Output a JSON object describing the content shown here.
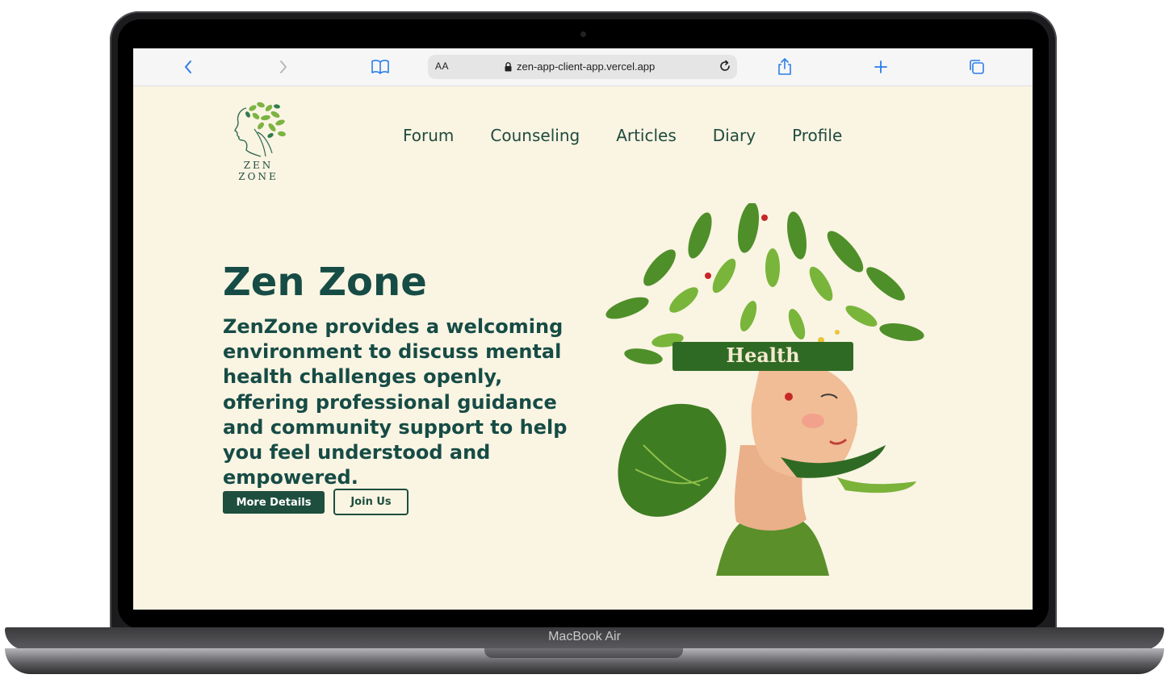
{
  "browser": {
    "text_size_label": "AA",
    "url": "zen-app-client-app.vercel.app",
    "icons": [
      "chevron-left-icon",
      "chevron-right-icon",
      "book-icon",
      "lock-icon",
      "reload-icon",
      "share-icon",
      "plus-icon",
      "tabs-icon"
    ]
  },
  "site": {
    "logo_text": "ZEN ZONE",
    "nav": [
      "Forum",
      "Counseling",
      "Articles",
      "Diary",
      "Profile"
    ]
  },
  "hero": {
    "title": "Zen Zone",
    "description": "ZenZone provides a welcoming environment to discuss mental health challenges openly, offering professional guidance and community support to help you feel understood and empowered.",
    "buttons": {
      "primary": "More Details",
      "secondary": "Join Us"
    },
    "illustration_banner": "Health"
  },
  "device": {
    "model": "MacBook Air"
  },
  "colors": {
    "page_bg": "#faf4e3",
    "brand": "#164c45",
    "button": "#1e4e3e",
    "browser_accent": "#2b7de9"
  }
}
